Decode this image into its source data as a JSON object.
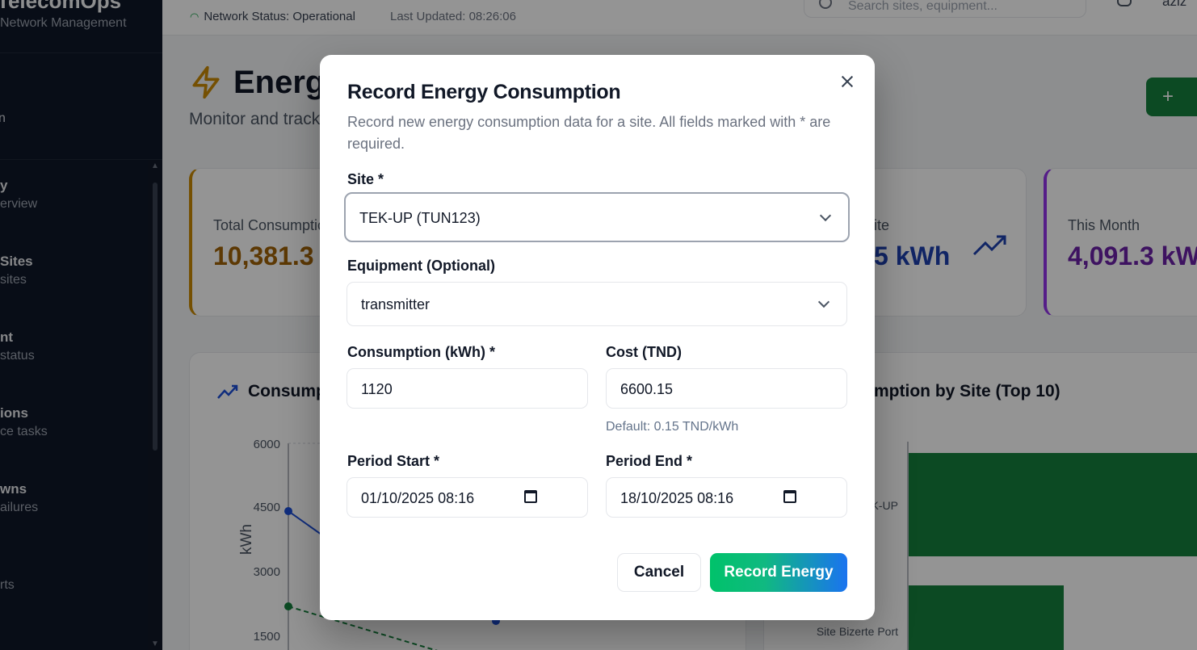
{
  "sidebar": {
    "brand_title": "TelecomOps",
    "brand_sub": "Network Management",
    "top_label": "n",
    "items": [
      {
        "title": "y",
        "sub": "erview"
      },
      {
        "title": "Sites",
        "sub": "sites"
      },
      {
        "title": "nt",
        "sub": "status"
      },
      {
        "title": "ions",
        "sub": "ce tasks"
      },
      {
        "title": "wns",
        "sub": "ailures"
      },
      {
        "title": "",
        "sub": "rts"
      }
    ]
  },
  "topbar": {
    "network_status": "Network Status: Operational",
    "last_updated": "Last Updated: 08:26:06",
    "search_placeholder": "Search sites, equipment...",
    "user": "aziz"
  },
  "page": {
    "title": "Energy",
    "subtitle": "Monitor and track"
  },
  "stats": [
    {
      "label": "Total Consumption",
      "value": "10,381.3",
      "color": "#a16207"
    },
    {
      "label": "ite",
      "value": "5 kWh",
      "color": "#1e40af"
    },
    {
      "label": "This Month",
      "value": "4,091.3 kWh",
      "color": "#6b21a8"
    }
  ],
  "panels": {
    "left_title": "Consumption",
    "right_title": "mption by Site (Top 10)",
    "y_ticks": [
      "6000",
      "4500",
      "3000",
      "1500"
    ],
    "y_label": "kWh",
    "bar_labels": [
      "TEK-UP",
      "Site Bizerte Port"
    ]
  },
  "modal": {
    "title": "Record Energy Consumption",
    "description": "Record new energy consumption data for a site. All fields marked with * are required.",
    "site_label": "Site *",
    "site_value": "TEK-UP (TUN123)",
    "equipment_label": "Equipment (Optional)",
    "equipment_value": "transmitter",
    "consumption_label": "Consumption (kWh) *",
    "consumption_value": "1120",
    "cost_label": "Cost (TND)",
    "cost_value": "6600.15",
    "cost_hint": "Default: 0.15 TND/kWh",
    "period_start_label": "Period Start *",
    "period_start_value": "01/10/2025  08:16",
    "period_end_label": "Period End *",
    "period_end_value": "18/10/2025  08:16",
    "cancel_label": "Cancel",
    "submit_label": "Record Energy"
  },
  "colors": {
    "primary_green": "#15803d",
    "gradient_start": "#00c26a",
    "gradient_end": "#1a73f0"
  }
}
